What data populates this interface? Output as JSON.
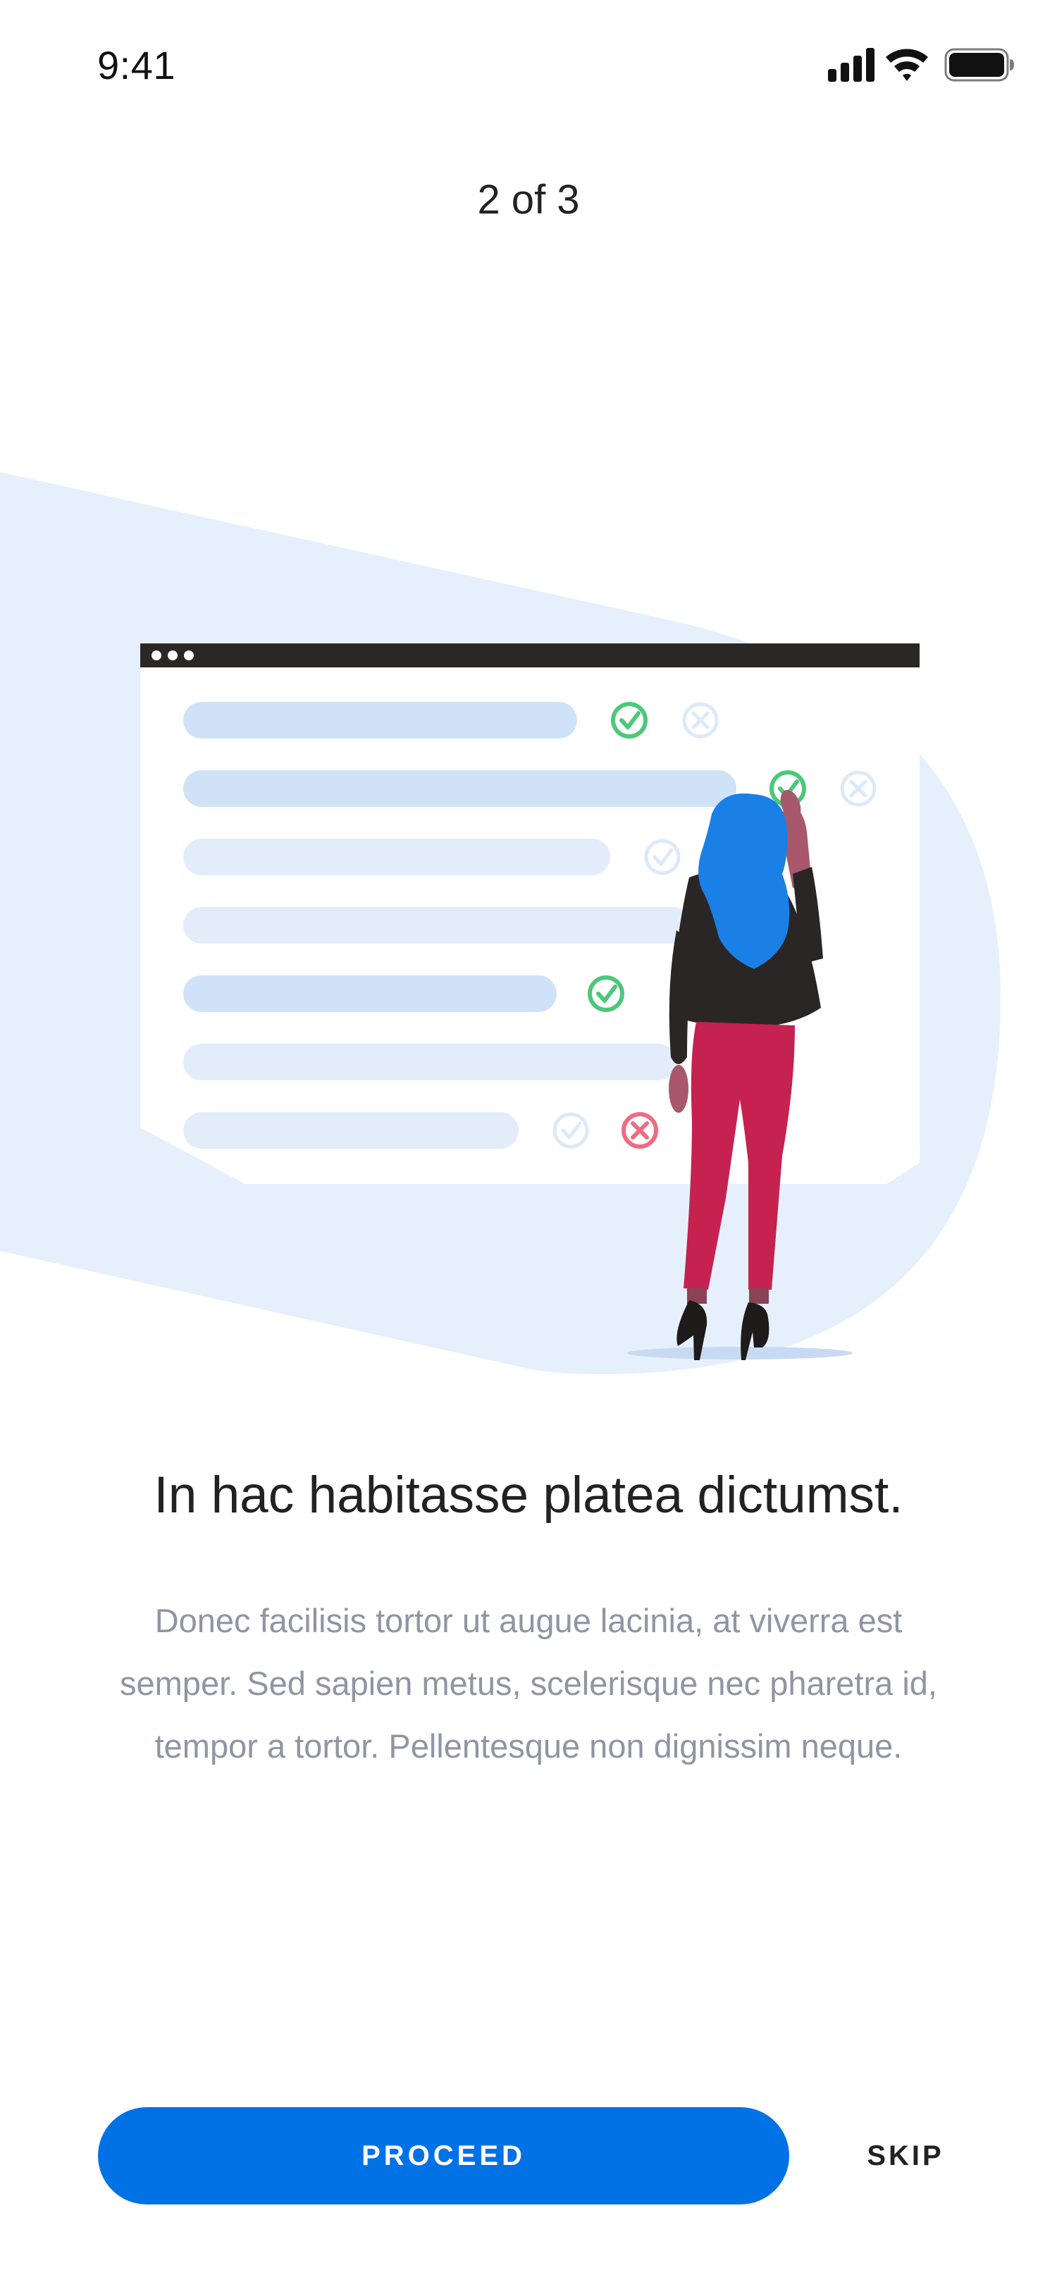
{
  "status_bar": {
    "time": "9:41",
    "icons": [
      "cellular-signal-icon",
      "wifi-icon",
      "battery-icon"
    ]
  },
  "onboarding": {
    "pager_text": "2 of 3",
    "headline": "In hac habitasse platea dictumst.",
    "body": "Donec facilisis tortor ut augue lacinia, at viverra est semper. Sed sapien metus, scelerisque nec pharetra id, tempor a tortor. Pellentesque non dignissim neque."
  },
  "illustration": {
    "subject": "woman checking a list on a browser window",
    "colors": {
      "backdrop": "#e6f0fc",
      "window_bar": "#2b2727",
      "list_bar": "#cfe2f8",
      "list_bar_faded": "#e3edf9",
      "check_green": "#4cc87a",
      "cross_red": "#ee6b84",
      "hair": "#1a80e6",
      "jacket": "#2b2626",
      "pants": "#c5224f"
    }
  },
  "actions": {
    "proceed_label": "PROCEED",
    "skip_label": "SKIP"
  },
  "theme": {
    "primary": "#0072e5",
    "text_dark": "#222222",
    "text_muted": "#8f95a3"
  }
}
